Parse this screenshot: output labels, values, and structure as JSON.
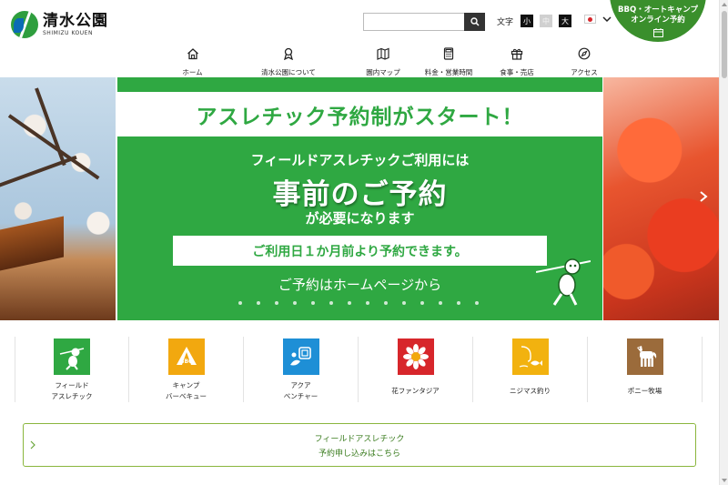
{
  "header": {
    "logo_name": "清水公園",
    "logo_sub": "SHIMIZU KOUEN",
    "search_placeholder": "",
    "fontsize_label": "文字",
    "fontsize_small": "小",
    "fontsize_mid": "中",
    "fontsize_big": "大",
    "bbq_line1": "BBQ・オートキャンプ",
    "bbq_line2": "オンライン予約"
  },
  "nav": {
    "items": [
      {
        "label": "ホーム",
        "icon": "home-icon"
      },
      {
        "label": "清水公園について",
        "icon": "ribbon-icon"
      },
      {
        "label": "園内マップ",
        "icon": "map-icon"
      },
      {
        "label": "料金・営業時間",
        "icon": "calculator-icon"
      },
      {
        "label": "食事・売店",
        "icon": "gift-icon"
      },
      {
        "label": "アクセス",
        "icon": "compass-icon"
      }
    ]
  },
  "hero": {
    "title": "アスレチック予約制がスタート！",
    "line1": "フィールドアスレチックご利用には",
    "big": "事前のご予約",
    "line3": "が必要になります",
    "box": "ご利用日１か月前より予約できます。",
    "foot": "ご予約はホームページから",
    "dot_count": 14
  },
  "categories": [
    {
      "line1": "フィールド",
      "line2": "アスレチック",
      "color": "#2fa842",
      "icon": "athletic-icon"
    },
    {
      "line1": "キャンプ",
      "line2": "バーベキュー",
      "color": "#f2a80f",
      "icon": "camp-bbq-icon"
    },
    {
      "line1": "アクア",
      "line2": "ベンチャー",
      "color": "#1e8fd6",
      "icon": "aqua-icon"
    },
    {
      "line1": "花ファンタジア",
      "line2": "",
      "color": "#d7262b",
      "icon": "flower-icon"
    },
    {
      "line1": "ニジマス釣り",
      "line2": "",
      "color": "#f2b20f",
      "icon": "fishing-icon"
    },
    {
      "line1": "ポニー牧場",
      "line2": "",
      "color": "#9b6b3b",
      "icon": "pony-icon"
    }
  ],
  "cta": {
    "line1": "フィールドアスレチック",
    "line2": "予約申し込みはこちら"
  }
}
